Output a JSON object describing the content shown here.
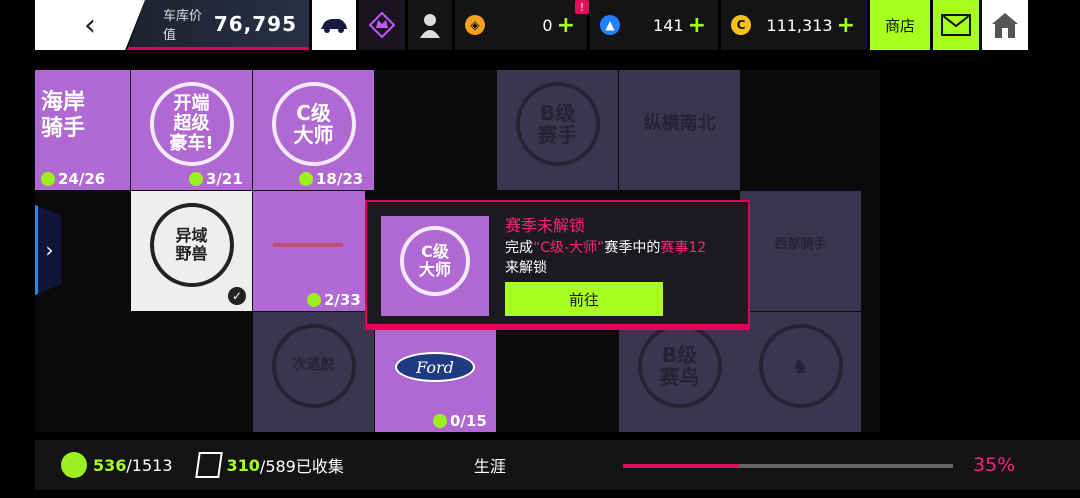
{
  "header": {
    "back_icon": "chevron-left-icon",
    "garage_label": "车库价值",
    "garage_value": "76,795",
    "currencies": [
      {
        "icon": "token-icon",
        "value": "0",
        "badge": "!"
      },
      {
        "icon": "credit-icon",
        "value": "141"
      },
      {
        "icon": "gold-coin-icon",
        "value": "111,313"
      }
    ],
    "shop_label": "商店"
  },
  "tiles": {
    "t1_label": "海岸\n骑手",
    "t1_prog": "24/26",
    "t2_label": "开端\n超级\n豪车!",
    "t2_prog": "3/21",
    "t3_label": "C级\n大师",
    "t3_prog": "18/23",
    "t4_label": "B级\n赛手",
    "t5_label": "纵横南北",
    "t6_label": "异域\n野兽",
    "t7_prog": "2/33",
    "t8_label": "西部骑手",
    "t9_label": "次逃脱",
    "t10_label": "Ford",
    "t10_prog": "0/15",
    "t11_label": "B级\n赛鸟"
  },
  "popup": {
    "title": "赛季未解锁",
    "desc_prefix": "完成",
    "desc_highlight1": "“C级-大师”",
    "desc_middle": "赛季中的",
    "desc_highlight2": "赛事12",
    "desc_suffix": "来解锁",
    "image_label": "C级\n大师",
    "go_label": "前往"
  },
  "footer": {
    "flags_have": "536",
    "flags_total": "/1513",
    "cards_have": "310",
    "cards_total": "/589已收集",
    "career_label": "生涯",
    "progress": 0.35,
    "progress_text": "35%"
  },
  "colors": {
    "accent_green": "#a8ff1e",
    "accent_pink": "#e0005a",
    "tile_purple": "#b069d3"
  }
}
